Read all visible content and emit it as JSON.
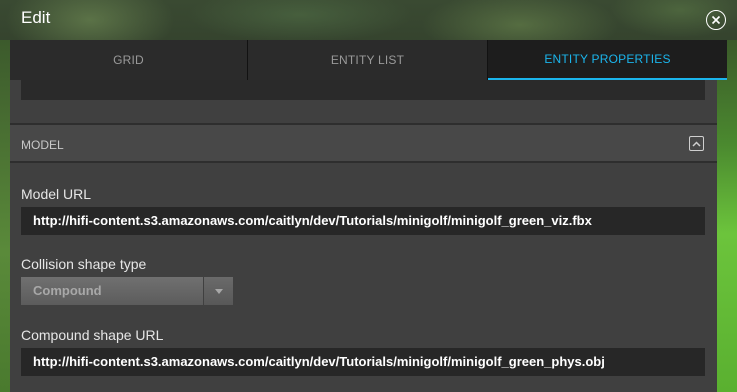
{
  "window": {
    "title": "Edit",
    "close_icon": "close-circle-icon"
  },
  "tabs": [
    {
      "label": "GRID",
      "active": false
    },
    {
      "label": "ENTITY LIST",
      "active": false
    },
    {
      "label": "ENTITY PROPERTIES",
      "active": true
    }
  ],
  "section": {
    "label": "MODEL",
    "collapse_icon": "chevron-up-icon"
  },
  "fields": {
    "model_url": {
      "label": "Model URL",
      "value": "http://hifi-content.s3.amazonaws.com/caitlyn/dev/Tutorials/minigolf/minigolf_green_viz.fbx"
    },
    "collision_shape": {
      "label": "Collision shape type",
      "selected": "Compound"
    },
    "compound_url": {
      "label": "Compound shape URL",
      "value": "http://hifi-content.s3.amazonaws.com/caitlyn/dev/Tutorials/minigolf/minigolf_green_phys.obj"
    }
  },
  "colors": {
    "accent": "#1bb5ec",
    "panel": "#404040",
    "field": "#272727"
  }
}
